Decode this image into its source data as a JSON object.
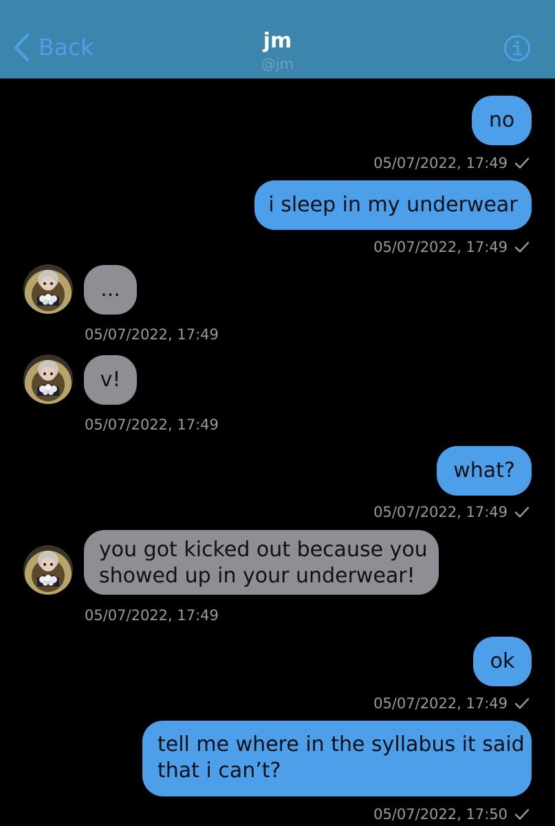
{
  "header": {
    "back_label": "Back",
    "title": "jm",
    "subtitle": "@jm",
    "background": "#3c86ad",
    "accent": "#4d9fea"
  },
  "icons": {
    "back": "chevron-left-icon",
    "info": "info-circle-icon",
    "read": "checkmark-icon"
  },
  "messages": [
    {
      "direction": "outgoing",
      "text": "no",
      "timestamp": "05/07/2022, 17:49"
    },
    {
      "direction": "outgoing",
      "text": "i sleep in my underwear",
      "timestamp": "05/07/2022, 17:49"
    },
    {
      "direction": "incoming",
      "text": "...",
      "timestamp": "05/07/2022, 17:49"
    },
    {
      "direction": "incoming",
      "text": "v!",
      "timestamp": "05/07/2022, 17:49"
    },
    {
      "direction": "outgoing",
      "text": "what?",
      "timestamp": "05/07/2022, 17:49"
    },
    {
      "direction": "incoming",
      "lines": [
        "you got kicked out because you",
        "showed up in your underwear!"
      ],
      "timestamp": "05/07/2022, 17:49"
    },
    {
      "direction": "outgoing",
      "text": "ok",
      "timestamp": "05/07/2022, 17:49"
    },
    {
      "direction": "outgoing",
      "lines": [
        "tell me where in the syllabus it said",
        "that i can’t?"
      ],
      "timestamp": "05/07/2022, 17:50"
    }
  ],
  "colors": {
    "outgoing_bubble": "#4d9fea",
    "incoming_bubble": "#8e8e94",
    "timestamp": "#9a9aa0"
  }
}
